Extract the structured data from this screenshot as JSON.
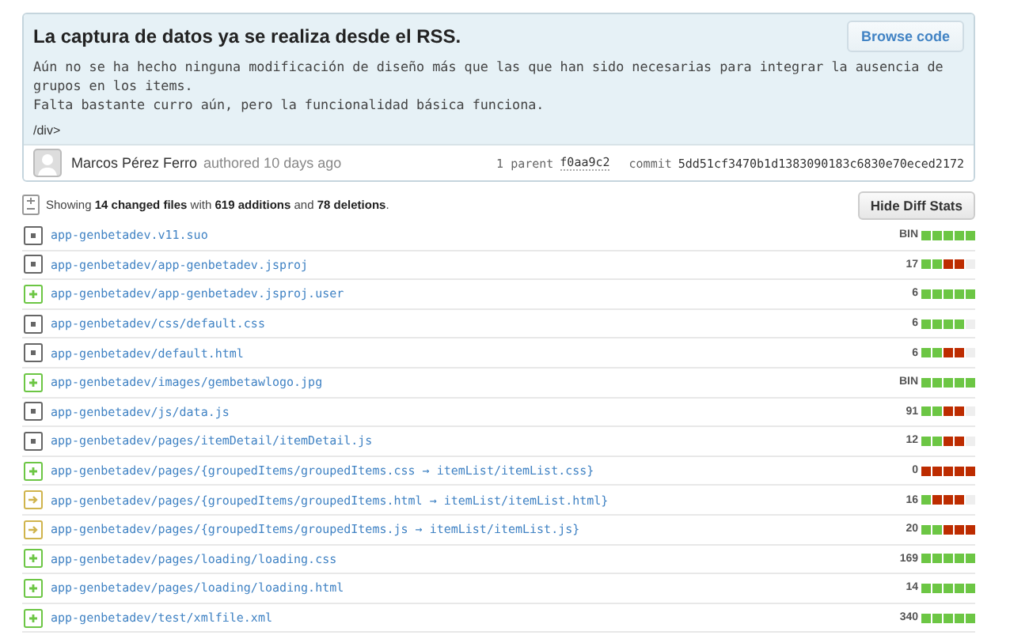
{
  "commit": {
    "title": "La captura de datos ya se realiza desde el RSS.",
    "browse_button": "Browse code",
    "description": [
      "Aún no se ha hecho ninguna modificación de diseño más que las que han sido necesarias para integrar la ausencia de grupos en los items.",
      "Falta bastante curro aún, pero la funcionalidad básica funciona."
    ],
    "trailer": "/div>",
    "author": "Marcos Pérez Ferro",
    "authored": "authored 10 days ago",
    "parent_label": "1 parent",
    "parent_sha": "f0aa9c2",
    "commit_label": "commit",
    "commit_sha": "5dd51cf3470b1d1383090183c6830e70eced2172"
  },
  "summary": {
    "text": "Showing **14 changed files** with **619 additions** and **78 deletions**.",
    "button": "Hide Diff Stats"
  },
  "files": [
    {
      "kind": "modified",
      "path": "app-genbetadev.v11.suo",
      "count": "BIN",
      "blocks": [
        {
          "kind": "add"
        },
        {
          "kind": "add"
        },
        {
          "kind": "add"
        },
        {
          "kind": "add"
        },
        {
          "kind": "add"
        }
      ]
    },
    {
      "kind": "modified",
      "path": "app-genbetadev/app-genbetadev.jsproj",
      "count": "17",
      "blocks": [
        {
          "kind": "add"
        },
        {
          "kind": "add"
        },
        {
          "kind": "del"
        },
        {
          "kind": "del"
        },
        {
          "kind": "none"
        }
      ]
    },
    {
      "kind": "added",
      "path": "app-genbetadev/app-genbetadev.jsproj.user",
      "count": "6",
      "blocks": [
        {
          "kind": "add"
        },
        {
          "kind": "add"
        },
        {
          "kind": "add"
        },
        {
          "kind": "add"
        },
        {
          "kind": "add"
        }
      ]
    },
    {
      "kind": "modified",
      "path": "app-genbetadev/css/default.css",
      "count": "6",
      "blocks": [
        {
          "kind": "add"
        },
        {
          "kind": "add"
        },
        {
          "kind": "add"
        },
        {
          "kind": "add"
        },
        {
          "kind": "none"
        }
      ]
    },
    {
      "kind": "modified",
      "path": "app-genbetadev/default.html",
      "count": "6",
      "blocks": [
        {
          "kind": "add"
        },
        {
          "kind": "add"
        },
        {
          "kind": "del"
        },
        {
          "kind": "del"
        },
        {
          "kind": "none"
        }
      ]
    },
    {
      "kind": "added",
      "path": "app-genbetadev/images/gembetawlogo.jpg",
      "count": "BIN",
      "blocks": [
        {
          "kind": "add"
        },
        {
          "kind": "add"
        },
        {
          "kind": "add"
        },
        {
          "kind": "add"
        },
        {
          "kind": "add"
        }
      ]
    },
    {
      "kind": "modified",
      "path": "app-genbetadev/js/data.js",
      "count": "91",
      "blocks": [
        {
          "kind": "add"
        },
        {
          "kind": "add"
        },
        {
          "kind": "del"
        },
        {
          "kind": "del"
        },
        {
          "kind": "none"
        }
      ]
    },
    {
      "kind": "modified",
      "path": "app-genbetadev/pages/itemDetail/itemDetail.js",
      "count": "12",
      "blocks": [
        {
          "kind": "add"
        },
        {
          "kind": "add"
        },
        {
          "kind": "del"
        },
        {
          "kind": "del"
        },
        {
          "kind": "none"
        }
      ]
    },
    {
      "kind": "added",
      "path": "app-genbetadev/pages/{groupedItems/groupedItems.css → itemList/itemList.css}",
      "count": "0",
      "blocks": [
        {
          "kind": "del"
        },
        {
          "kind": "del"
        },
        {
          "kind": "del"
        },
        {
          "kind": "del"
        },
        {
          "kind": "del"
        }
      ]
    },
    {
      "kind": "renamed",
      "path": "app-genbetadev/pages/{groupedItems/groupedItems.html → itemList/itemList.html}",
      "count": "16",
      "blocks": [
        {
          "kind": "add"
        },
        {
          "kind": "del"
        },
        {
          "kind": "del"
        },
        {
          "kind": "del"
        },
        {
          "kind": "none"
        }
      ]
    },
    {
      "kind": "renamed",
      "path": "app-genbetadev/pages/{groupedItems/groupedItems.js → itemList/itemList.js}",
      "count": "20",
      "blocks": [
        {
          "kind": "add"
        },
        {
          "kind": "add"
        },
        {
          "kind": "del"
        },
        {
          "kind": "del"
        },
        {
          "kind": "del"
        }
      ]
    },
    {
      "kind": "added",
      "path": "app-genbetadev/pages/loading/loading.css",
      "count": "169",
      "blocks": [
        {
          "kind": "add"
        },
        {
          "kind": "add"
        },
        {
          "kind": "add"
        },
        {
          "kind": "add"
        },
        {
          "kind": "add"
        }
      ]
    },
    {
      "kind": "added",
      "path": "app-genbetadev/pages/loading/loading.html",
      "count": "14",
      "blocks": [
        {
          "kind": "add"
        },
        {
          "kind": "add"
        },
        {
          "kind": "add"
        },
        {
          "kind": "add"
        },
        {
          "kind": "add"
        }
      ]
    },
    {
      "kind": "added",
      "path": "app-genbetadev/test/xmlfile.xml",
      "count": "340",
      "blocks": [
        {
          "kind": "add"
        },
        {
          "kind": "add"
        },
        {
          "kind": "add"
        },
        {
          "kind": "add"
        },
        {
          "kind": "add"
        }
      ]
    }
  ]
}
